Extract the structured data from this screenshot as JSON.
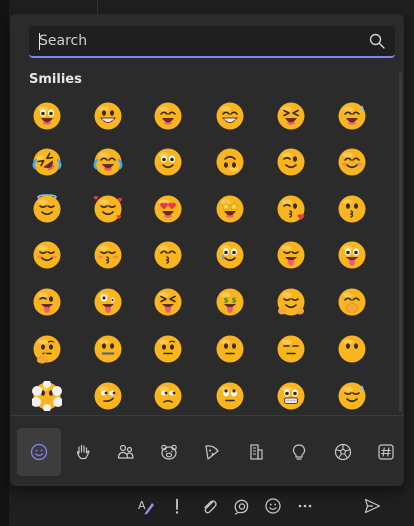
{
  "search": {
    "placeholder": "Search",
    "value": ""
  },
  "section": {
    "title": "Smilies"
  },
  "emojis": [
    "grinning-face",
    "grinning-face-big-eyes",
    "grinning-face-smiling-eyes",
    "beaming-face",
    "grinning-squinting-face",
    "grinning-face-sweat",
    "rolling-on-floor-laughing",
    "face-tears-of-joy",
    "slightly-smiling-face",
    "upside-down-face",
    "winking-face",
    "smiling-face-smiling-eyes",
    "smiling-face-halo",
    "smiling-face-hearts",
    "smiling-face-heart-eyes",
    "star-struck",
    "face-blowing-kiss",
    "kissing-face",
    "smiling-face",
    "kissing-face-closed-eyes",
    "kissing-face-smiling-eyes",
    "smiling-face-with-tear",
    "face-savoring-food",
    "face-with-tongue",
    "winking-face-tongue",
    "zany-face",
    "squinting-face-tongue",
    "money-mouth-face",
    "smiling-face-open-hands",
    "face-hand-over-mouth",
    "thinking-face",
    "zipper-mouth-face",
    "face-raised-eyebrow",
    "neutral-face",
    "expressionless-face",
    "face-without-mouth",
    "face-in-clouds",
    "smirking-face",
    "unamused-face",
    "face-rolling-eyes",
    "grimacing-face",
    "relieved-face"
  ],
  "categories": [
    {
      "name": "smilies",
      "icon": "smiley-icon",
      "active": true
    },
    {
      "name": "hand-gestures",
      "icon": "hand-icon",
      "active": false
    },
    {
      "name": "people",
      "icon": "people-icon",
      "active": false
    },
    {
      "name": "animals",
      "icon": "bear-icon",
      "active": false
    },
    {
      "name": "food",
      "icon": "pizza-icon",
      "active": false
    },
    {
      "name": "travel-places",
      "icon": "building-icon",
      "active": false
    },
    {
      "name": "objects",
      "icon": "lightbulb-icon",
      "active": false
    },
    {
      "name": "activities",
      "icon": "soccer-ball-icon",
      "active": false
    },
    {
      "name": "symbols",
      "icon": "hash-icon",
      "active": false
    }
  ],
  "toolbar": [
    "format-icon",
    "important-icon",
    "attach-icon",
    "loop-icon",
    "emoji-icon",
    "more-icon",
    "send-icon"
  ],
  "colors": {
    "accent": "#7f85f5",
    "picker_bg": "#2b2b2b",
    "emoji_face": "#f9b51f",
    "emoji_cheek": "#f15f6f",
    "icon": "#c8c8c8"
  }
}
